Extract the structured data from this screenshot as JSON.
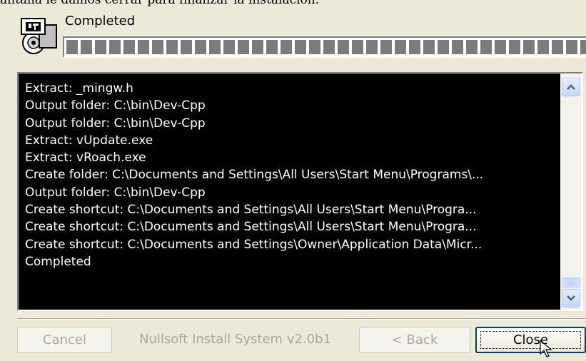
{
  "window": {
    "caption_partial": "antalla le damos cerrar para finalizar la instalación."
  },
  "status": {
    "text": "Completed",
    "progress_percent": 100
  },
  "log": {
    "lines": [
      "Extract: _mingw.h",
      "Output folder: C:\\bin\\Dev-Cpp",
      "Output folder: C:\\bin\\Dev-Cpp",
      "Extract: vUpdate.exe",
      "Extract: vRoach.exe",
      "Create folder: C:\\Documents and Settings\\All Users\\Start Menu\\Programs\\...",
      "Output folder: C:\\bin\\Dev-Cpp",
      "Create shortcut: C:\\Documents and Settings\\All Users\\Start Menu\\Progra...",
      "Create shortcut: C:\\Documents and Settings\\All Users\\Start Menu\\Progra...",
      "Create shortcut: C:\\Documents and Settings\\Owner\\Application Data\\Micr...",
      "Completed"
    ]
  },
  "buttons": {
    "cancel": "Cancel",
    "back": "< Back",
    "close": "Close"
  },
  "branding": "Nullsoft Install System v2.0b1",
  "icons": {
    "installer": "installer-icon",
    "scroll_up": "arrow-up-icon",
    "scroll_down": "arrow-down-icon",
    "cursor": "mouse-cursor-icon"
  },
  "colors": {
    "window_bg": "#ece9d8",
    "log_bg": "#000000",
    "log_text": "#ffffff",
    "progress_block": "#7b7b7b",
    "disabled_text": "#aca899",
    "focus_border": "#003c74"
  }
}
